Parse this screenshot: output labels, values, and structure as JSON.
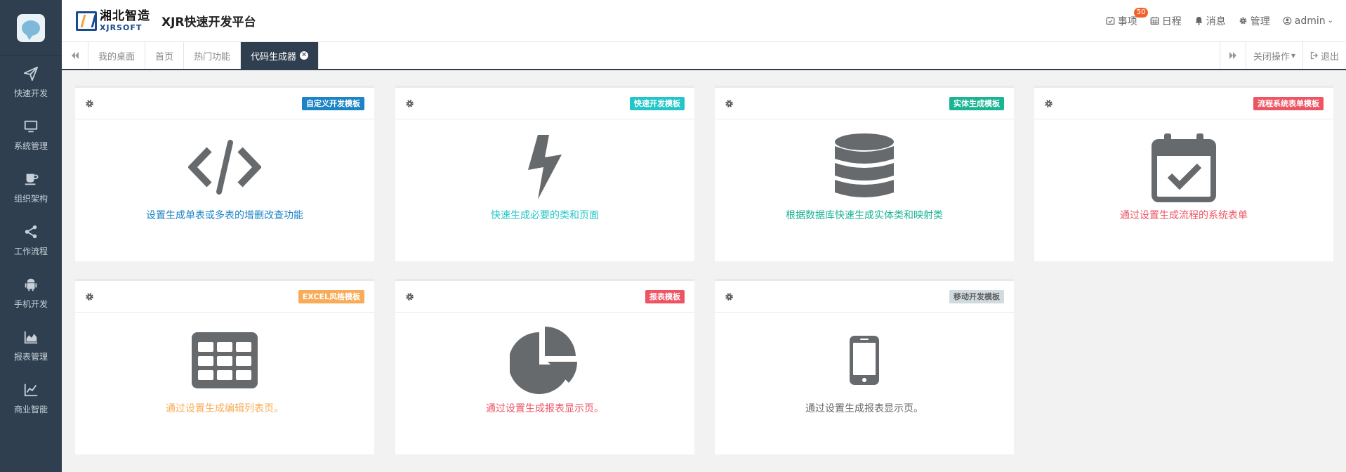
{
  "brand": {
    "cn": "湘北智造",
    "en": "XJRSOFT",
    "title": "XJR快速开发平台"
  },
  "header": {
    "items": [
      {
        "label": "事项",
        "icon": "calendar-check-icon",
        "badge": "50"
      },
      {
        "label": "日程",
        "icon": "calendar-icon"
      },
      {
        "label": "消息",
        "icon": "bell-icon"
      },
      {
        "label": "管理",
        "icon": "gear-icon"
      },
      {
        "label": "admin",
        "icon": "user-icon"
      }
    ]
  },
  "sidebar": {
    "items": [
      {
        "label": "快速开发",
        "icon": "paper-plane-icon"
      },
      {
        "label": "系统管理",
        "icon": "monitor-icon"
      },
      {
        "label": "组织架构",
        "icon": "coffee-icon"
      },
      {
        "label": "工作流程",
        "icon": "share-icon"
      },
      {
        "label": "手机开发",
        "icon": "android-icon"
      },
      {
        "label": "报表管理",
        "icon": "area-chart-icon"
      },
      {
        "label": "商业智能",
        "icon": "line-chart-icon"
      }
    ]
  },
  "tabs": {
    "items": [
      "我的桌面",
      "首页",
      "热门功能",
      "代码生成器"
    ],
    "active": "代码生成器",
    "close_glyph": "✕",
    "close_ops": "关闭操作",
    "logout": "退出"
  },
  "cards": [
    {
      "tag": "自定义开发模板",
      "tag_color": "#1c84c6",
      "desc": "设置生成单表或多表的增删改查功能",
      "desc_color": "#1c84c6",
      "icon": "code-icon"
    },
    {
      "tag": "快速开发模板",
      "tag_color": "#23c6c8",
      "desc": "快速生成必要的类和页面",
      "desc_color": "#23c6c8",
      "icon": "bolt-icon"
    },
    {
      "tag": "实体生成模板",
      "tag_color": "#1ab394",
      "desc": "根据数据库快速生成实体类和映射类",
      "desc_color": "#1ab394",
      "icon": "database-icon"
    },
    {
      "tag": "流程系统表单模板",
      "tag_color": "#ed5565",
      "desc": "通过设置生成流程的系统表单",
      "desc_color": "#ed5565",
      "icon": "calendar-check-icon"
    },
    {
      "tag": "EXCEL风格模板",
      "tag_color": "#f8ac59",
      "desc": "通过设置生成编辑列表页。",
      "desc_color": "#f8ac59",
      "icon": "table-icon"
    },
    {
      "tag": "报表模板",
      "tag_color": "#ed5565",
      "desc": "通过设置生成报表显示页。",
      "desc_color": "#ed5565",
      "icon": "pie-chart-icon"
    },
    {
      "tag": "移动开发模板",
      "tag_color": "#d1dade",
      "tag_text_color": "#5e5e5e",
      "desc": "通过设置生成报表显示页。",
      "desc_color": "#676a6c",
      "icon": "mobile-icon"
    }
  ],
  "colors": {
    "sidebar_bg": "#2f3f4f",
    "icon_gray": "#676a6c"
  }
}
